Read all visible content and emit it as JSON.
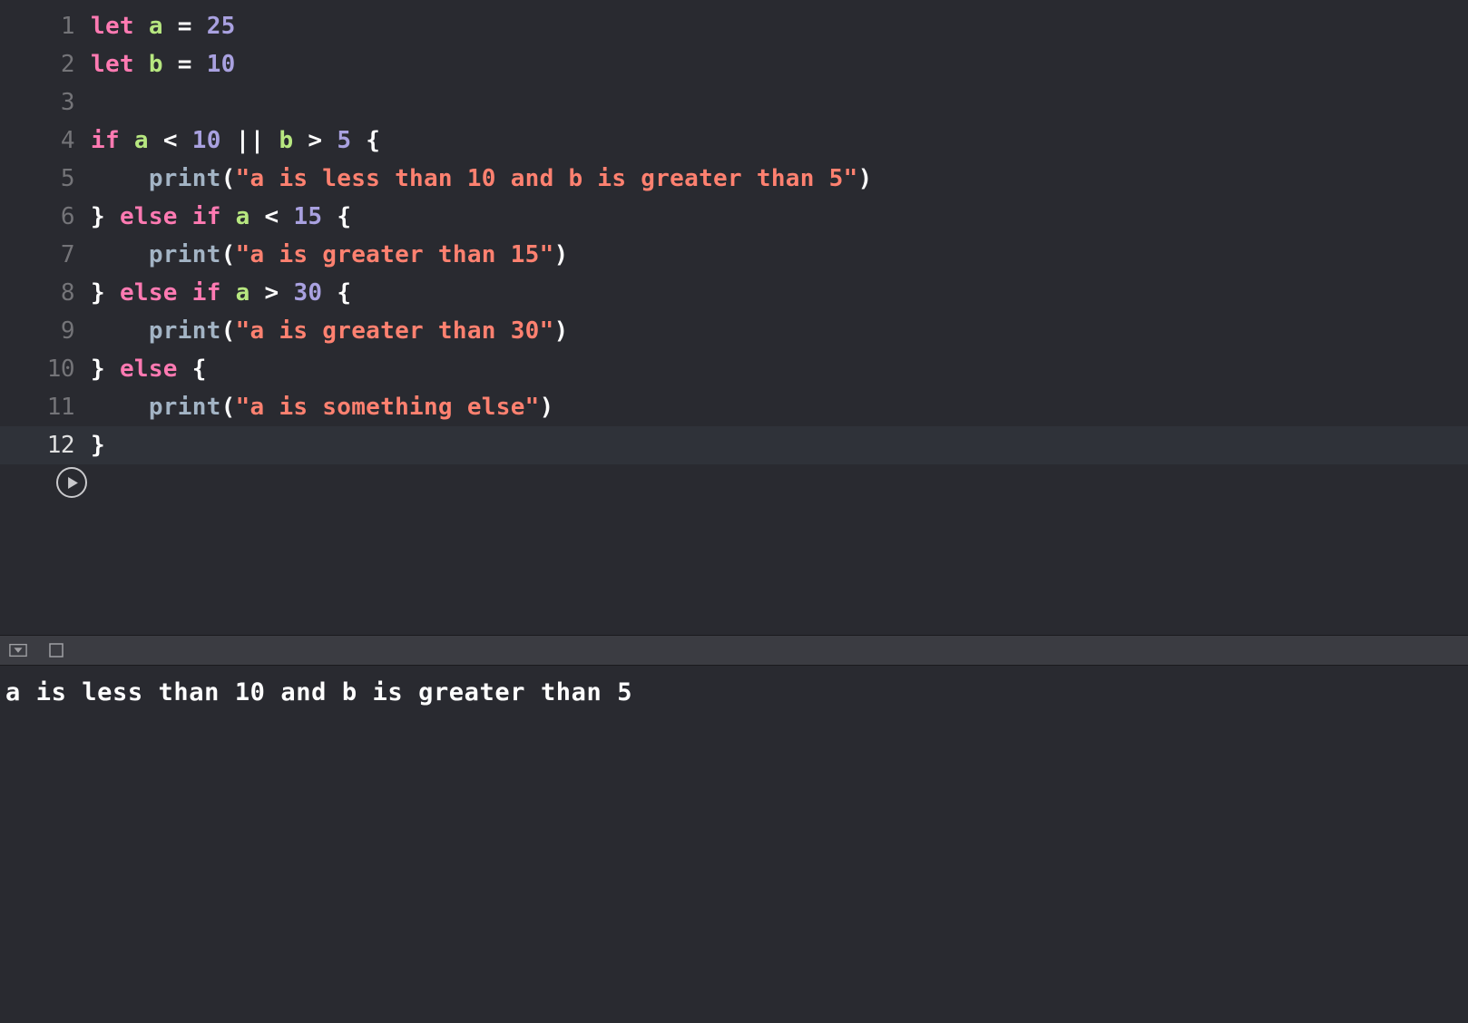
{
  "editor": {
    "highlightedLine": 12,
    "lines": [
      {
        "n": 1,
        "tokens": [
          [
            "kw",
            "let"
          ],
          [
            "op",
            " "
          ],
          [
            "ident",
            "a"
          ],
          [
            "op",
            " = "
          ],
          [
            "num",
            "25"
          ]
        ]
      },
      {
        "n": 2,
        "tokens": [
          [
            "kw",
            "let"
          ],
          [
            "op",
            " "
          ],
          [
            "ident",
            "b"
          ],
          [
            "op",
            " = "
          ],
          [
            "num",
            "10"
          ]
        ]
      },
      {
        "n": 3,
        "tokens": []
      },
      {
        "n": 4,
        "tokens": [
          [
            "kw",
            "if"
          ],
          [
            "op",
            " "
          ],
          [
            "ident",
            "a"
          ],
          [
            "op",
            " < "
          ],
          [
            "num",
            "10"
          ],
          [
            "op",
            " || "
          ],
          [
            "ident",
            "b"
          ],
          [
            "op",
            " > "
          ],
          [
            "num",
            "5"
          ],
          [
            "op",
            " "
          ],
          [
            "brace",
            "{"
          ]
        ]
      },
      {
        "n": 5,
        "tokens": [
          [
            "op",
            "    "
          ],
          [
            "func",
            "print"
          ],
          [
            "paren",
            "("
          ],
          [
            "str",
            "\"a is less than 10 and b is greater than 5\""
          ],
          [
            "paren",
            ")"
          ]
        ]
      },
      {
        "n": 6,
        "tokens": [
          [
            "brace",
            "}"
          ],
          [
            "op",
            " "
          ],
          [
            "kw",
            "else"
          ],
          [
            "op",
            " "
          ],
          [
            "kw",
            "if"
          ],
          [
            "op",
            " "
          ],
          [
            "ident",
            "a"
          ],
          [
            "op",
            " < "
          ],
          [
            "num",
            "15"
          ],
          [
            "op",
            " "
          ],
          [
            "brace",
            "{"
          ]
        ]
      },
      {
        "n": 7,
        "tokens": [
          [
            "op",
            "    "
          ],
          [
            "func",
            "print"
          ],
          [
            "paren",
            "("
          ],
          [
            "str",
            "\"a is greater than 15\""
          ],
          [
            "paren",
            ")"
          ]
        ]
      },
      {
        "n": 8,
        "tokens": [
          [
            "brace",
            "}"
          ],
          [
            "op",
            " "
          ],
          [
            "kw",
            "else"
          ],
          [
            "op",
            " "
          ],
          [
            "kw",
            "if"
          ],
          [
            "op",
            " "
          ],
          [
            "ident",
            "a"
          ],
          [
            "op",
            " > "
          ],
          [
            "num",
            "30"
          ],
          [
            "op",
            " "
          ],
          [
            "brace",
            "{"
          ]
        ]
      },
      {
        "n": 9,
        "tokens": [
          [
            "op",
            "    "
          ],
          [
            "func",
            "print"
          ],
          [
            "paren",
            "("
          ],
          [
            "str",
            "\"a is greater than 30\""
          ],
          [
            "paren",
            ")"
          ]
        ]
      },
      {
        "n": 10,
        "tokens": [
          [
            "brace",
            "}"
          ],
          [
            "op",
            " "
          ],
          [
            "kw",
            "else"
          ],
          [
            "op",
            " "
          ],
          [
            "brace",
            "{"
          ]
        ]
      },
      {
        "n": 11,
        "tokens": [
          [
            "op",
            "    "
          ],
          [
            "func",
            "print"
          ],
          [
            "paren",
            "("
          ],
          [
            "str",
            "\"a is something else\""
          ],
          [
            "paren",
            ")"
          ]
        ]
      },
      {
        "n": 12,
        "tokens": [
          [
            "brace",
            "}"
          ]
        ]
      }
    ]
  },
  "console": {
    "output": "a is less than 10 and b is greater than 5"
  }
}
